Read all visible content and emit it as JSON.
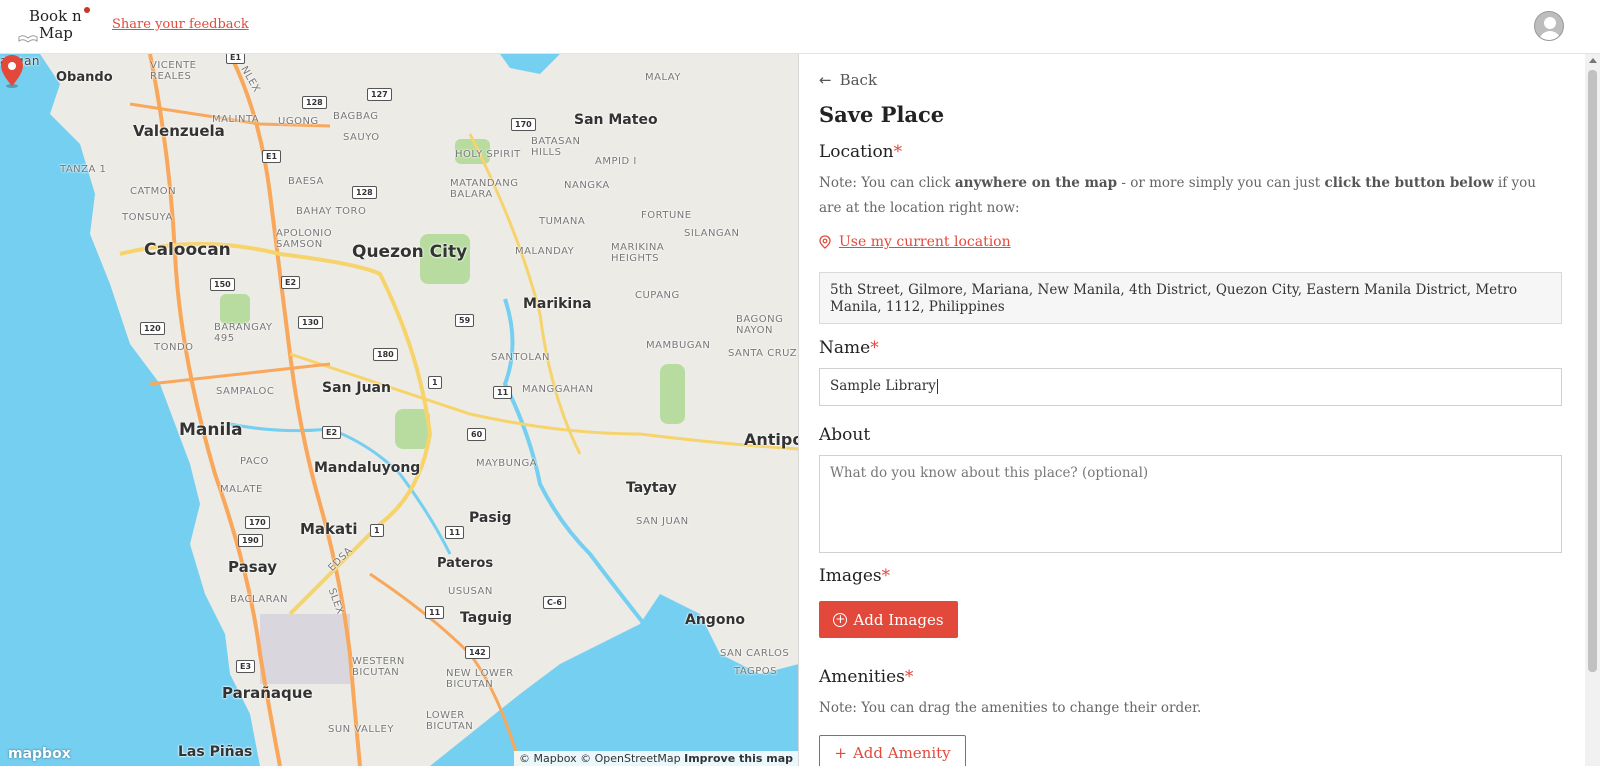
{
  "header": {
    "logo_line1": "Book n",
    "logo_line2": "Map",
    "feedback_link": "Share your feedback"
  },
  "map": {
    "labels": {
      "angan": "angan",
      "obando": "Obando",
      "valenzuela": "Valenzuela",
      "caloocan": "Caloocan",
      "quezon_city": "Quezon City",
      "san_mateo": "San Mateo",
      "marikina": "Marikina",
      "san_juan": "San Juan",
      "manila": "Manila",
      "mandaluyong": "Mandaluyong",
      "makati": "Makati",
      "pasig": "Pasig",
      "taytay": "Taytay",
      "pasay": "Pasay",
      "pateros": "Pateros",
      "taguig": "Taguig",
      "angono": "Angono",
      "paranaque": "Parañaque",
      "antipo": "Antipo",
      "las_pinas": "Las Piñas",
      "city_partial": "City",
      "vicente_reales": "VICENTE\nREALES",
      "malinta": "MALINTA",
      "ugong": "UGONG",
      "bagbag": "BAGBAG",
      "sauyo": "SAUYO",
      "holy_spirit": "HOLY SPIRIT",
      "batasan_hills": "BATASAN\nHILLS",
      "ampid": "AMPID I",
      "malaya": "MALAY",
      "tanza": "TANZA 1",
      "catmon": "CATMON",
      "tonsuya": "TONSUYA",
      "baesa": "BAESA",
      "bahay_toro": "BAHAY TORO",
      "matandang_balara": "MATANDANG\nBALARA",
      "nangka": "NANGKA",
      "tumana": "TUMANA",
      "fortune": "FORTUNE",
      "silangan": "SILANGAN",
      "apolonio_samson": "APOLONIO\nSAMSON",
      "malanday": "MALANDAY",
      "marikina_heights": "MARIKINA\nHEIGHTS",
      "cupang": "CUPANG",
      "barangay_495": "BARANGAY\n495",
      "tondo": "TONDO",
      "bagong_nayon": "BAGONG\nNAYON",
      "santolan": "SANTOLAN",
      "mambugan": "MAMBUGAN",
      "santa_cruz": "SANTA CRUZ",
      "sampaloc": "SAMPALOC",
      "manggahan": "MANGGAHAN",
      "paco": "PACO",
      "maybunga": "MAYBUNGA",
      "malate": "MALATE",
      "san_juan_small": "SAN JUAN",
      "baclaran": "BACLARAN",
      "usugan": "USUSAN",
      "san_carlos": "SAN CARLOS",
      "tagpos": "TAGPOS",
      "western_bicutan": "WESTERN\nBICUTAN",
      "new_lower_bicutan": "NEW LOWER\nBICUTAN",
      "lower_bicutan": "LOWER\nBICUTAN",
      "sun_valley": "SUN VALLEY",
      "edsa": "EDSA",
      "nlex": "NLEX",
      "slex": "SLEX"
    },
    "shields": {
      "e1": "E1",
      "e1b": "E1",
      "r128": "128",
      "r127": "127",
      "r170": "170",
      "r128b": "128",
      "e2": "E2",
      "r150": "150",
      "r130": "130",
      "r59": "59",
      "r120": "120",
      "r180": "180",
      "r1": "1",
      "r11": "11",
      "e2b": "E2",
      "r60": "60",
      "r170b": "170",
      "r190": "190",
      "r1b": "1",
      "r11b": "11",
      "r11c": "11",
      "c6": "C-6",
      "r142": "142",
      "e3": "E3"
    },
    "attribution": "© Mapbox © OpenStreetMap",
    "improve": "Improve this map",
    "logo": "mapbox",
    "colors": {
      "water": "#75cff0",
      "land": "#ecebe6",
      "green": "#b8dca0",
      "major_road": "#f9a75a",
      "primary_road": "#f7d36b",
      "marker": "#e2493b"
    }
  },
  "panel": {
    "back_label": "Back",
    "title": "Save Place",
    "location_label": "Location",
    "required_mark": "*",
    "location_note_1": "Note: You can click ",
    "location_note_2": "anywhere on the map",
    "location_note_3": " - or more simply you can just ",
    "location_note_4": "click the button below",
    "location_note_5": " if you are at the location right now:",
    "use_location": "Use my current location",
    "address": "5th Street, Gilmore, Mariana, New Manila, 4th District, Quezon City, Eastern Manila District, Metro Manila, 1112, Philippines",
    "name_label": "Name",
    "name_value": "Sample Library",
    "about_label": "About",
    "about_placeholder": "What do you know about this place? (optional)",
    "images_label": "Images",
    "add_images": "Add Images",
    "amenities_label": "Amenities",
    "amenities_note": "Note: You can drag the amenities to change their order.",
    "add_amenity": "Add Amenity"
  },
  "accent_color": "#e2493b"
}
